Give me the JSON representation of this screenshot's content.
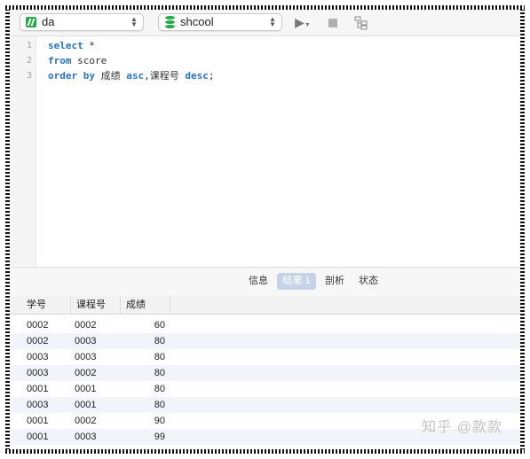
{
  "toolbar": {
    "connection": "da",
    "database": "shcool",
    "run_icon": "play-icon",
    "stop_icon": "stop-icon",
    "explain_icon": "explain-icon"
  },
  "editor": {
    "lines": [
      {
        "num": "1",
        "parts": [
          {
            "t": "select",
            "kw": true
          },
          {
            "t": " *",
            "kw": false
          }
        ]
      },
      {
        "num": "2",
        "parts": [
          {
            "t": "from",
            "kw": true
          },
          {
            "t": " score",
            "kw": false
          }
        ]
      },
      {
        "num": "3",
        "parts": [
          {
            "t": "order by",
            "kw": true
          },
          {
            "t": " 成绩 ",
            "kw": false
          },
          {
            "t": "asc",
            "kw": true
          },
          {
            "t": ",课程号 ",
            "kw": false
          },
          {
            "t": "desc",
            "kw": true
          },
          {
            "t": ";",
            "kw": false
          }
        ]
      }
    ]
  },
  "tabs": [
    {
      "label": "信息",
      "active": false
    },
    {
      "label": "结果 1",
      "active": true
    },
    {
      "label": "剖析",
      "active": false
    },
    {
      "label": "状态",
      "active": false
    }
  ],
  "table": {
    "columns": [
      "学号",
      "课程号",
      "成绩"
    ],
    "rows": [
      [
        "0002",
        "0002",
        "60"
      ],
      [
        "0002",
        "0003",
        "80"
      ],
      [
        "0003",
        "0003",
        "80"
      ],
      [
        "0003",
        "0002",
        "80"
      ],
      [
        "0001",
        "0001",
        "80"
      ],
      [
        "0003",
        "0001",
        "80"
      ],
      [
        "0001",
        "0002",
        "90"
      ],
      [
        "0001",
        "0003",
        "99"
      ]
    ]
  },
  "watermark": "知乎 @款款"
}
